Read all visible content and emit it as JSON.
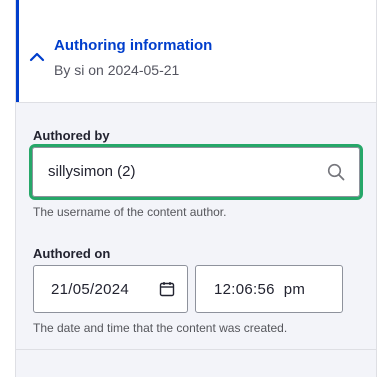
{
  "section": {
    "title": "Authoring information",
    "meta": "By si on 2024-05-21",
    "toggle_icon": "chevron-up-icon",
    "accent_color": "#003ecc"
  },
  "authored_by": {
    "label": "Authored by",
    "value": "sillysimon (2)",
    "icon": "search-icon",
    "focus_color": "#26a769",
    "description": "The username of the content author."
  },
  "authored_on": {
    "label": "Authored on",
    "date_value": "21/05/2024",
    "date_icon": "calendar-icon",
    "time_value": "12:06:56  pm",
    "description": "The date and time that the content was created."
  }
}
